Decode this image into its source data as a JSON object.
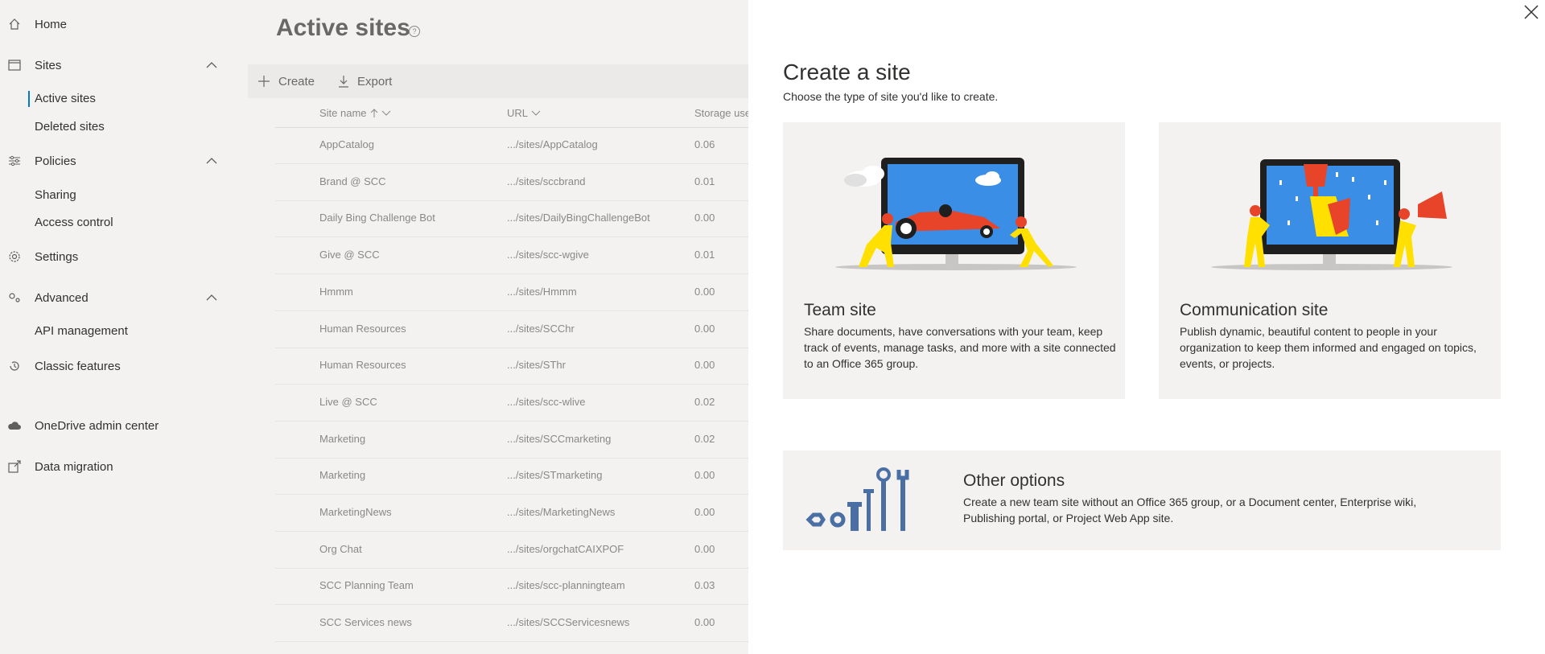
{
  "sidebar": {
    "home": "Home",
    "sites": "Sites",
    "active_sites": "Active sites",
    "deleted_sites": "Deleted sites",
    "policies": "Policies",
    "sharing": "Sharing",
    "access_control": "Access control",
    "settings": "Settings",
    "advanced": "Advanced",
    "api_management": "API management",
    "classic_features": "Classic features",
    "onedrive_admin_center": "OneDrive admin center",
    "data_migration": "Data migration"
  },
  "main": {
    "title": "Active sites",
    "help": "?",
    "create_label": "Create",
    "export_label": "Export",
    "columns": {
      "site_name": "Site name",
      "url": "URL",
      "storage": "Storage use"
    },
    "rows": [
      {
        "name": "AppCatalog",
        "url": ".../sites/AppCatalog",
        "storage": "0.06"
      },
      {
        "name": "Brand @ SCC",
        "url": ".../sites/sccbrand",
        "storage": "0.01"
      },
      {
        "name": "Daily Bing Challenge Bot",
        "url": ".../sites/DailyBingChallengeBot",
        "storage": "0.00"
      },
      {
        "name": "Give @ SCC",
        "url": ".../sites/scc-wgive",
        "storage": "0.01"
      },
      {
        "name": "Hmmm",
        "url": ".../sites/Hmmm",
        "storage": "0.00"
      },
      {
        "name": "Human Resources",
        "url": ".../sites/SCChr",
        "storage": "0.00"
      },
      {
        "name": "Human Resources",
        "url": ".../sites/SThr",
        "storage": "0.00"
      },
      {
        "name": "Live @ SCC",
        "url": ".../sites/scc-wlive",
        "storage": "0.02"
      },
      {
        "name": "Marketing",
        "url": ".../sites/SCCmarketing",
        "storage": "0.02"
      },
      {
        "name": "Marketing",
        "url": ".../sites/STmarketing",
        "storage": "0.00"
      },
      {
        "name": "MarketingNews",
        "url": ".../sites/MarketingNews",
        "storage": "0.00"
      },
      {
        "name": "Org Chat",
        "url": ".../sites/orgchatCAIXPOF",
        "storage": "0.00"
      },
      {
        "name": "SCC Planning Team",
        "url": ".../sites/scc-planningteam",
        "storage": "0.03"
      },
      {
        "name": "SCC Services news",
        "url": ".../sites/SCCServicesnews",
        "storage": "0.00"
      }
    ]
  },
  "panel": {
    "title": "Create a site",
    "subtitle": "Choose the type of site you'd like to create.",
    "team_site": {
      "title": "Team site",
      "description": "Share documents, have conversations with your team, keep track of events, manage tasks, and more with a site connected to an Office 365 group."
    },
    "communication_site": {
      "title": "Communication site",
      "description": "Publish dynamic, beautiful content to people in your organization to keep them informed and engaged on topics, events, or projects."
    },
    "other_options": {
      "title": "Other options",
      "description": "Create a new team site without an Office 365 group, or a Document center, Enterprise wiki, Publishing portal, or Project Web App site."
    }
  },
  "colors": {
    "accent": "#0078d4",
    "sidebar_bg": "#f3f2f1",
    "card_bg": "#f3f2f1",
    "tool_blue": "#4a6fa5"
  }
}
